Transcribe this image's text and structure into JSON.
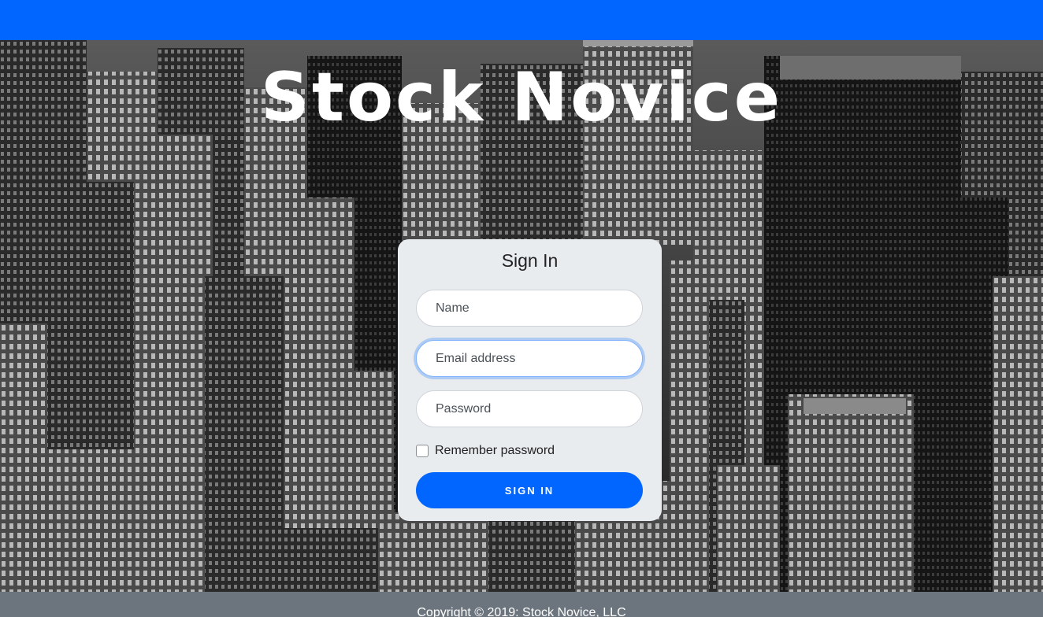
{
  "brand": {
    "title": "Stock Novice",
    "navbar_color": "#0066ff"
  },
  "hero": {
    "background": "grayscale-city-skyline-aerial"
  },
  "signin": {
    "heading": "Sign In",
    "name_placeholder": "Name",
    "email_placeholder": "Email address",
    "password_placeholder": "Password",
    "remember_label": "Remember password",
    "remember_checked": false,
    "button_label": "SIGN IN",
    "button_color": "#0066ff",
    "focused_field": "email"
  },
  "footer": {
    "text": "Copyright © 2019: Stock Novice, LLC"
  }
}
